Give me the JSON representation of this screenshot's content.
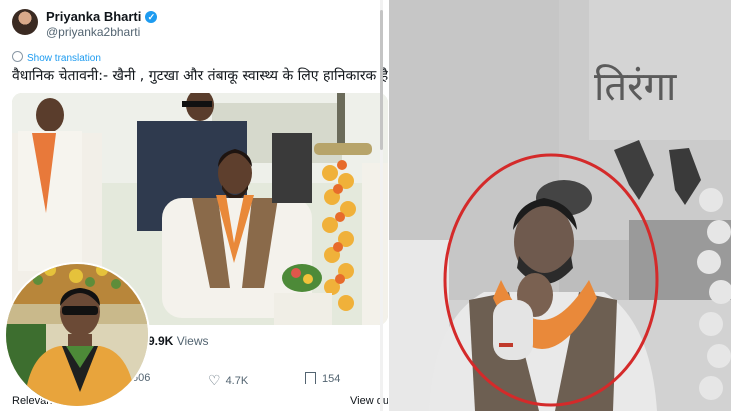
{
  "tweet": {
    "author_name": "Priyanka Bharti",
    "handle": "@priyanka2bharti",
    "show_translation": "Show translation",
    "text": "वैधानिक चेतावनी:- खैनी , गुटखा और तंबाकू स्वास्थ्य के लिए हानिकारक है।",
    "views_count": "9.9K",
    "views_label": "Views",
    "replies_count": "606",
    "likes_count": "4.7K",
    "bookmarks_count": "154",
    "relevant_label": "Relevant",
    "view_quotes_label": "View qu"
  },
  "right_panel": {
    "wall_text": "तिरंगा"
  },
  "colors": {
    "accent": "#1d9bf0",
    "circle": "#d42a2a",
    "vest": "#8a6a4a",
    "saffron": "#e9893a"
  }
}
